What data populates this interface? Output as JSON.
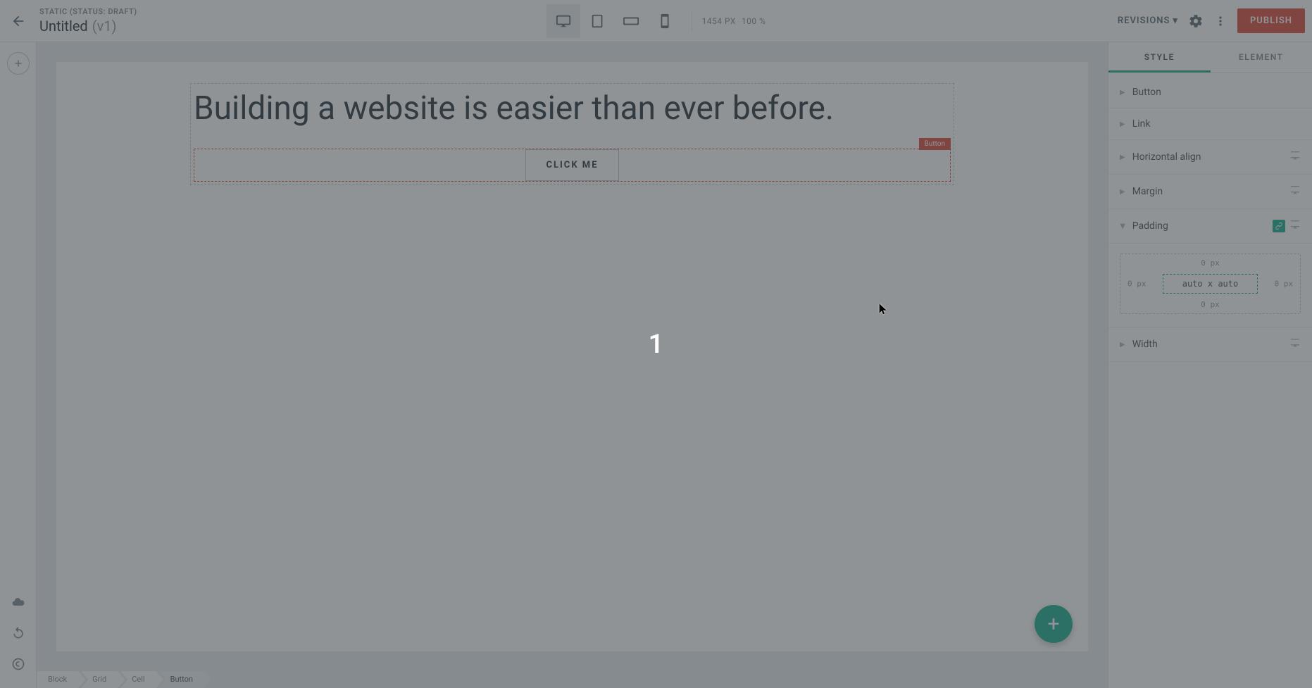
{
  "header": {
    "page_type": "STATIC",
    "status_prefix": "STATUS:",
    "status_value": "DRAFT",
    "title": "Untitled",
    "version": "(v1)",
    "canvas_width": "1454 PX",
    "zoom": "100 %",
    "revisions_label": "REVISIONS",
    "publish_label": "PUBLISH"
  },
  "canvas": {
    "heading_text": "Building a website is easier than ever before.",
    "button_label": "CLICK ME",
    "selection_tag": "Button"
  },
  "breadcrumb": [
    "Block",
    "Grid",
    "Cell",
    "Button"
  ],
  "sidebar": {
    "tabs": {
      "style": "STYLE",
      "element": "ELEMENT"
    },
    "active_tab": "style",
    "sections": [
      {
        "name": "Button",
        "open": false,
        "has_device": false
      },
      {
        "name": "Link",
        "open": false,
        "has_device": false
      },
      {
        "name": "Horizontal align",
        "open": false,
        "has_device": true
      },
      {
        "name": "Margin",
        "open": false,
        "has_device": true
      },
      {
        "name": "Padding",
        "open": true,
        "has_device": true,
        "has_link_badge": true
      },
      {
        "name": "Width",
        "open": false,
        "has_device": true
      }
    ],
    "padding": {
      "top": "0 px",
      "right": "0 px",
      "bottom": "0 px",
      "left": "0 px",
      "inner": "auto x auto"
    }
  },
  "overlay": {
    "counter": "1"
  }
}
